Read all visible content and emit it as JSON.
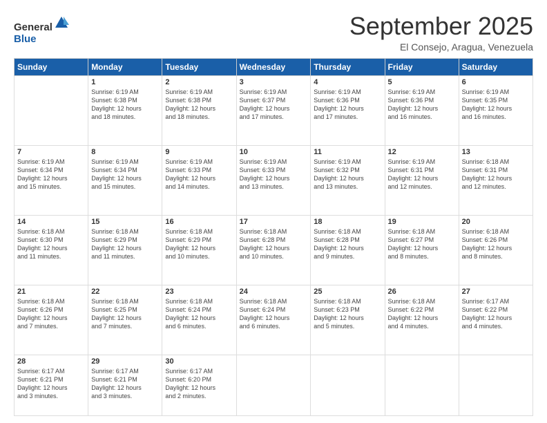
{
  "header": {
    "logo_general": "General",
    "logo_blue": "Blue",
    "month_title": "September 2025",
    "location": "El Consejo, Aragua, Venezuela"
  },
  "weekdays": [
    "Sunday",
    "Monday",
    "Tuesday",
    "Wednesday",
    "Thursday",
    "Friday",
    "Saturday"
  ],
  "weeks": [
    [
      {
        "day": "",
        "info": ""
      },
      {
        "day": "1",
        "info": "Sunrise: 6:19 AM\nSunset: 6:38 PM\nDaylight: 12 hours\nand 18 minutes."
      },
      {
        "day": "2",
        "info": "Sunrise: 6:19 AM\nSunset: 6:38 PM\nDaylight: 12 hours\nand 18 minutes."
      },
      {
        "day": "3",
        "info": "Sunrise: 6:19 AM\nSunset: 6:37 PM\nDaylight: 12 hours\nand 17 minutes."
      },
      {
        "day": "4",
        "info": "Sunrise: 6:19 AM\nSunset: 6:36 PM\nDaylight: 12 hours\nand 17 minutes."
      },
      {
        "day": "5",
        "info": "Sunrise: 6:19 AM\nSunset: 6:36 PM\nDaylight: 12 hours\nand 16 minutes."
      },
      {
        "day": "6",
        "info": "Sunrise: 6:19 AM\nSunset: 6:35 PM\nDaylight: 12 hours\nand 16 minutes."
      }
    ],
    [
      {
        "day": "7",
        "info": "Sunrise: 6:19 AM\nSunset: 6:34 PM\nDaylight: 12 hours\nand 15 minutes."
      },
      {
        "day": "8",
        "info": "Sunrise: 6:19 AM\nSunset: 6:34 PM\nDaylight: 12 hours\nand 15 minutes."
      },
      {
        "day": "9",
        "info": "Sunrise: 6:19 AM\nSunset: 6:33 PM\nDaylight: 12 hours\nand 14 minutes."
      },
      {
        "day": "10",
        "info": "Sunrise: 6:19 AM\nSunset: 6:33 PM\nDaylight: 12 hours\nand 13 minutes."
      },
      {
        "day": "11",
        "info": "Sunrise: 6:19 AM\nSunset: 6:32 PM\nDaylight: 12 hours\nand 13 minutes."
      },
      {
        "day": "12",
        "info": "Sunrise: 6:19 AM\nSunset: 6:31 PM\nDaylight: 12 hours\nand 12 minutes."
      },
      {
        "day": "13",
        "info": "Sunrise: 6:18 AM\nSunset: 6:31 PM\nDaylight: 12 hours\nand 12 minutes."
      }
    ],
    [
      {
        "day": "14",
        "info": "Sunrise: 6:18 AM\nSunset: 6:30 PM\nDaylight: 12 hours\nand 11 minutes."
      },
      {
        "day": "15",
        "info": "Sunrise: 6:18 AM\nSunset: 6:29 PM\nDaylight: 12 hours\nand 11 minutes."
      },
      {
        "day": "16",
        "info": "Sunrise: 6:18 AM\nSunset: 6:29 PM\nDaylight: 12 hours\nand 10 minutes."
      },
      {
        "day": "17",
        "info": "Sunrise: 6:18 AM\nSunset: 6:28 PM\nDaylight: 12 hours\nand 10 minutes."
      },
      {
        "day": "18",
        "info": "Sunrise: 6:18 AM\nSunset: 6:28 PM\nDaylight: 12 hours\nand 9 minutes."
      },
      {
        "day": "19",
        "info": "Sunrise: 6:18 AM\nSunset: 6:27 PM\nDaylight: 12 hours\nand 8 minutes."
      },
      {
        "day": "20",
        "info": "Sunrise: 6:18 AM\nSunset: 6:26 PM\nDaylight: 12 hours\nand 8 minutes."
      }
    ],
    [
      {
        "day": "21",
        "info": "Sunrise: 6:18 AM\nSunset: 6:26 PM\nDaylight: 12 hours\nand 7 minutes."
      },
      {
        "day": "22",
        "info": "Sunrise: 6:18 AM\nSunset: 6:25 PM\nDaylight: 12 hours\nand 7 minutes."
      },
      {
        "day": "23",
        "info": "Sunrise: 6:18 AM\nSunset: 6:24 PM\nDaylight: 12 hours\nand 6 minutes."
      },
      {
        "day": "24",
        "info": "Sunrise: 6:18 AM\nSunset: 6:24 PM\nDaylight: 12 hours\nand 6 minutes."
      },
      {
        "day": "25",
        "info": "Sunrise: 6:18 AM\nSunset: 6:23 PM\nDaylight: 12 hours\nand 5 minutes."
      },
      {
        "day": "26",
        "info": "Sunrise: 6:18 AM\nSunset: 6:22 PM\nDaylight: 12 hours\nand 4 minutes."
      },
      {
        "day": "27",
        "info": "Sunrise: 6:17 AM\nSunset: 6:22 PM\nDaylight: 12 hours\nand 4 minutes."
      }
    ],
    [
      {
        "day": "28",
        "info": "Sunrise: 6:17 AM\nSunset: 6:21 PM\nDaylight: 12 hours\nand 3 minutes."
      },
      {
        "day": "29",
        "info": "Sunrise: 6:17 AM\nSunset: 6:21 PM\nDaylight: 12 hours\nand 3 minutes."
      },
      {
        "day": "30",
        "info": "Sunrise: 6:17 AM\nSunset: 6:20 PM\nDaylight: 12 hours\nand 2 minutes."
      },
      {
        "day": "",
        "info": ""
      },
      {
        "day": "",
        "info": ""
      },
      {
        "day": "",
        "info": ""
      },
      {
        "day": "",
        "info": ""
      }
    ]
  ]
}
